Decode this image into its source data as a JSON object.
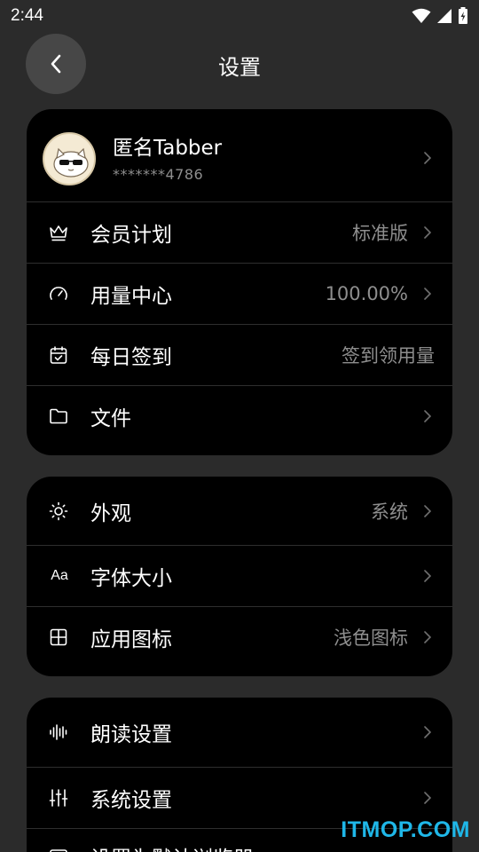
{
  "status_bar": {
    "time": "2:44",
    "icons": [
      "wifi-icon",
      "signal-icon",
      "battery-charging-icon"
    ]
  },
  "nav": {
    "back_icon": "chevron-left-icon",
    "title": "设置"
  },
  "profile": {
    "name": "匿名Tabber",
    "account": "*******4786",
    "avatar_icon": "cat-with-sunglasses-avatar"
  },
  "group1": [
    {
      "icon": "crown-icon",
      "label": "会员计划",
      "value": "标准版",
      "chevron": true
    },
    {
      "icon": "gauge-icon",
      "label": "用量中心",
      "value": "100.00%",
      "chevron": true
    },
    {
      "icon": "calendar-check-icon",
      "label": "每日签到",
      "value": "签到领用量",
      "chevron": false
    },
    {
      "icon": "folder-icon",
      "label": "文件",
      "value": "",
      "chevron": true
    }
  ],
  "group2": [
    {
      "icon": "sun-icon",
      "label": "外观",
      "value": "系统",
      "chevron": true
    },
    {
      "icon": "font-size-icon",
      "icon_text": "Aa",
      "label": "字体大小",
      "value": "",
      "chevron": true
    },
    {
      "icon": "grid-icon",
      "label": "应用图标",
      "value": "浅色图标",
      "chevron": true
    }
  ],
  "group3": [
    {
      "icon": "audio-wave-icon",
      "label": "朗读设置",
      "value": "",
      "chevron": true
    },
    {
      "icon": "sliders-icon",
      "label": "系统设置",
      "value": "",
      "chevron": true
    },
    {
      "icon": "browser-icon",
      "label": "设置为默认浏览器",
      "value": "",
      "chevron": true
    }
  ],
  "watermark": "ITMOP.COM",
  "colors": {
    "background": "#2b2b2b",
    "card": "#000000",
    "text": "#ffffff",
    "secondary_text": "#8e8e8e",
    "watermark": "#1fb7e8"
  }
}
